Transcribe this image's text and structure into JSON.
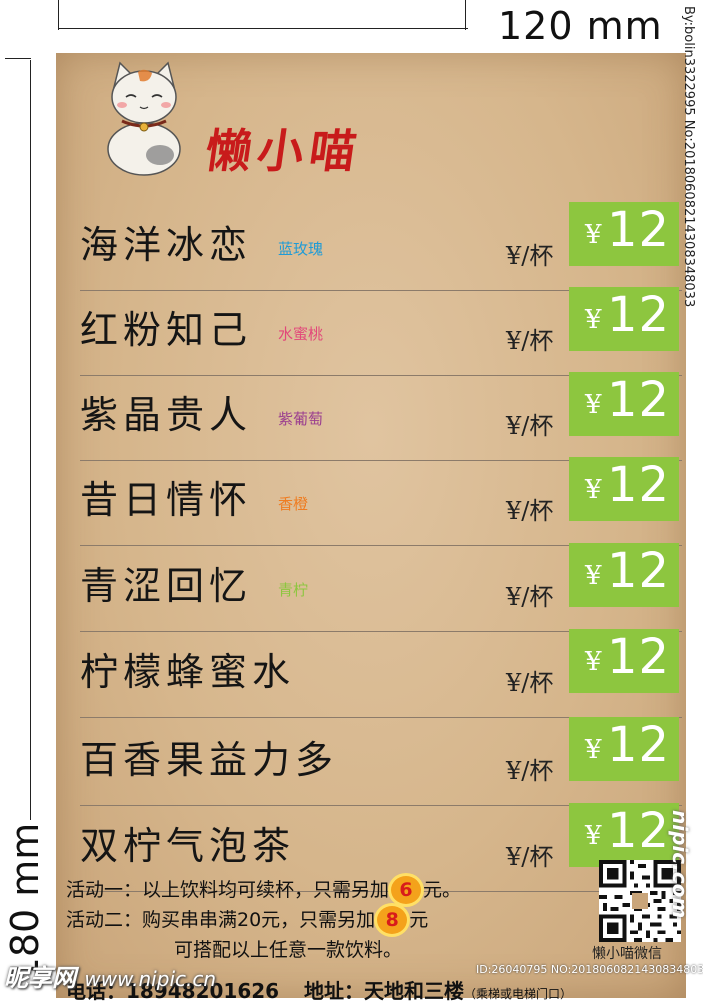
{
  "dimensions": {
    "width_label": "120 mm",
    "height_label": "180 mm"
  },
  "brand": "懒小喵",
  "items": [
    {
      "name": "海洋冰恋",
      "flavor": "蓝玫瑰",
      "flavor_color": "#1f9bd6",
      "unit": "¥/杯",
      "currency": "¥",
      "price": "12"
    },
    {
      "name": "红粉知己",
      "flavor": "水蜜桃",
      "flavor_color": "#e2477a",
      "unit": "¥/杯",
      "currency": "¥",
      "price": "12"
    },
    {
      "name": "紫晶贵人",
      "flavor": "紫葡萄",
      "flavor_color": "#9b3f8f",
      "unit": "¥/杯",
      "currency": "¥",
      "price": "12"
    },
    {
      "name": "昔日情怀",
      "flavor": "香橙",
      "flavor_color": "#ef7d22",
      "unit": "¥/杯",
      "currency": "¥",
      "price": "12"
    },
    {
      "name": "青涩回忆",
      "flavor": "青柠",
      "flavor_color": "#8dc63f",
      "unit": "¥/杯",
      "currency": "¥",
      "price": "12"
    },
    {
      "name": "柠檬蜂蜜水",
      "flavor": "",
      "flavor_color": "#000000",
      "unit": "¥/杯",
      "currency": "¥",
      "price": "12"
    },
    {
      "name": "百香果益力多",
      "flavor": "",
      "flavor_color": "#000000",
      "unit": "¥/杯",
      "currency": "¥",
      "price": "12"
    },
    {
      "name": "双柠气泡茶",
      "flavor": "",
      "flavor_color": "#000000",
      "unit": "¥/杯",
      "currency": "¥",
      "price": "12"
    }
  ],
  "promos": {
    "p1_lead": "活动一：以上饮料均可续杯，只需另加",
    "p1_amount": "6",
    "p1_tail": "元。",
    "p2_lead": "活动二：购买串串满20元，只需另加",
    "p2_amount": "8",
    "p2_tail": "元",
    "p2_cont": "可搭配以上任意一款饮料。"
  },
  "contact": {
    "phone_label": "电话：",
    "phone": "18948201626",
    "address_label": "地址：",
    "address": "天地和三楼",
    "address_note": "（乘梯或电梯门口）"
  },
  "qr_label": "懒小喵微信",
  "side_id": "By:bolin3322995 No:20180608214308348033",
  "watermark": {
    "site": "昵享网",
    "url": "www.nipic.cn",
    "id": "ID:26040795 NO:20180608214308348033",
    "right": "nipic.com"
  }
}
